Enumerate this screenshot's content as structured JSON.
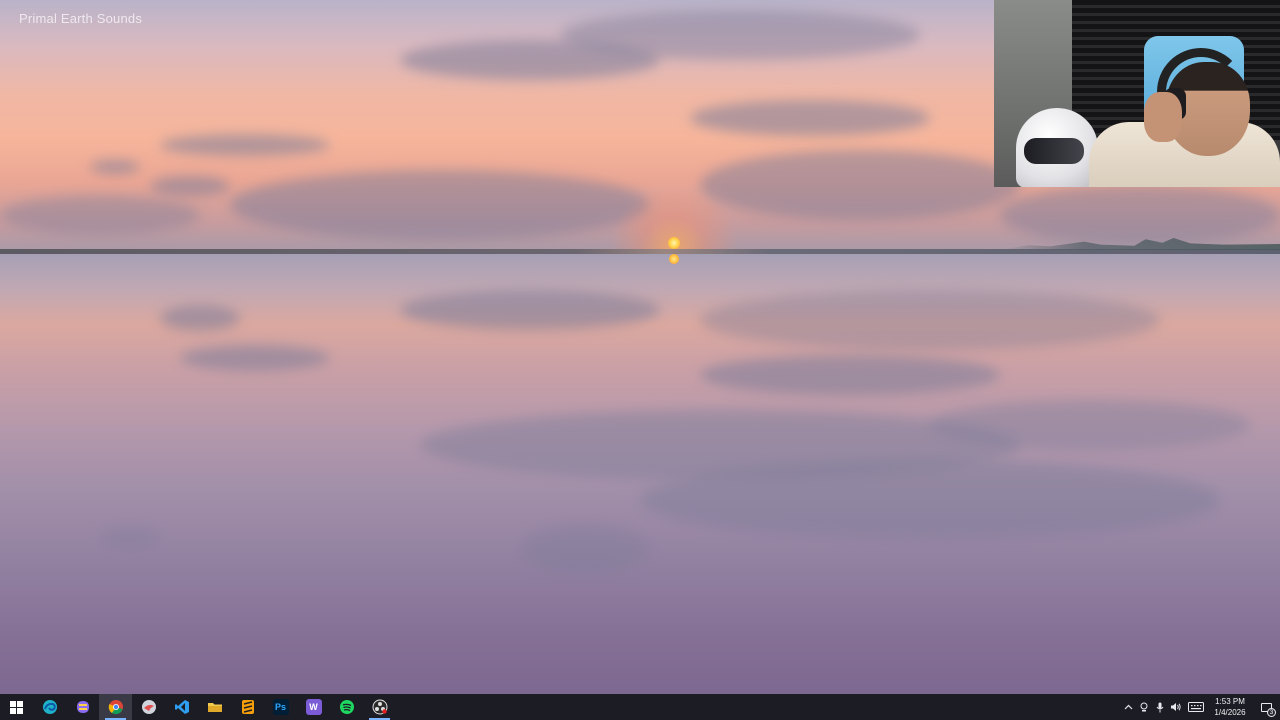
{
  "video": {
    "watermark": "Primal Earth Sounds"
  },
  "webcam": {
    "description_icon": "webcam-overlay"
  },
  "taskbar": {
    "apps": [
      {
        "name": "start",
        "icon": "windows-logo-icon",
        "label": "",
        "color": "#ffffff",
        "active": false,
        "running": false
      },
      {
        "name": "edge",
        "icon": "edge-icon",
        "label": "",
        "color": "#1fb2c9",
        "active": false,
        "running": false
      },
      {
        "name": "copilot",
        "icon": "copilot-icon",
        "label": "",
        "color": "#8a6cf0",
        "active": false,
        "running": false
      },
      {
        "name": "chrome",
        "icon": "chrome-icon",
        "label": "",
        "color": "#4caf50",
        "active": true,
        "running": true
      },
      {
        "name": "app-bird",
        "icon": "bird-app-icon",
        "label": "",
        "color": "#cfd4dd",
        "active": false,
        "running": false
      },
      {
        "name": "vscode",
        "icon": "vscode-icon",
        "label": "",
        "color": "#2f9ef0",
        "active": false,
        "running": false
      },
      {
        "name": "file-explorer",
        "icon": "folder-icon",
        "label": "",
        "color": "#f2c94c",
        "active": false,
        "running": false
      },
      {
        "name": "sublime",
        "icon": "sublime-text-icon",
        "label": "",
        "color": "#f59e0b",
        "active": false,
        "running": false
      },
      {
        "name": "photoshop",
        "icon": "photoshop-icon",
        "label": "Ps",
        "color": "#31a8ff",
        "active": false,
        "running": false
      },
      {
        "name": "w-app",
        "icon": "w-app-icon",
        "label": "W",
        "color": "#7b5cd6",
        "active": false,
        "running": false
      },
      {
        "name": "spotify",
        "icon": "spotify-icon",
        "label": "",
        "color": "#1ed760",
        "active": false,
        "running": false
      },
      {
        "name": "obs",
        "icon": "obs-icon",
        "label": "",
        "color": "#e0e0e0",
        "active": false,
        "running": true
      }
    ],
    "tray": {
      "time": "1:53 PM",
      "date": "1/4/2026",
      "notification_count": "3"
    }
  }
}
